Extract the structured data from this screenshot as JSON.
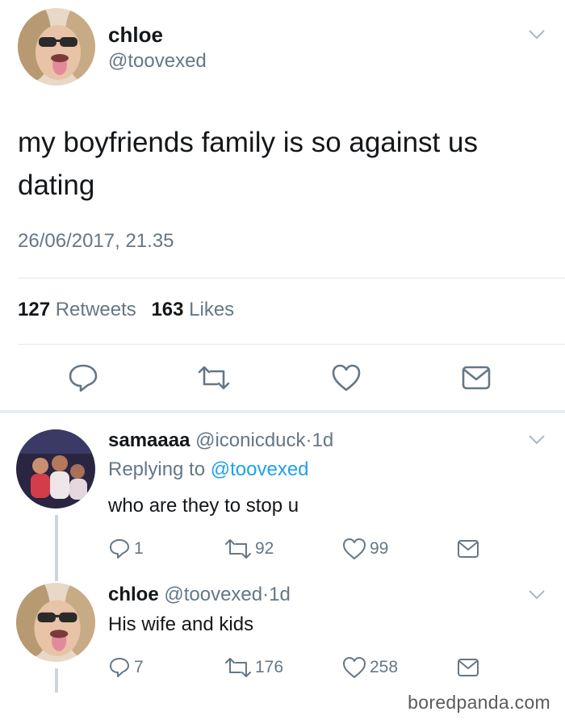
{
  "main_tweet": {
    "name": "chloe",
    "handle": "@toovexed",
    "text": "my boyfriends family is so against us dating",
    "timestamp": "26/06/2017, 21.35",
    "retweets_count": "127",
    "retweets_label": "Retweets",
    "likes_count": "163",
    "likes_label": "Likes",
    "actions": [
      "reply-icon",
      "retweet-icon",
      "like-icon",
      "message-icon"
    ]
  },
  "replies": [
    {
      "name": "samaaaa",
      "handle": "@iconicduck",
      "sep": "·",
      "time": "1d",
      "replying_prefix": "Replying to",
      "replying_to": "@toovexed",
      "text": "who are they to stop u",
      "reply_count": "1",
      "retweet_count": "92",
      "like_count": "99"
    },
    {
      "name": "chloe",
      "handle": "@toovexed",
      "sep": "·",
      "time": "1d",
      "text": "His wife and kids",
      "reply_count": "7",
      "retweet_count": "176",
      "like_count": "258"
    }
  ],
  "watermark": "boredpanda.com",
  "colors": {
    "text": "#14171a",
    "secondary": "#657786",
    "link": "#1da1f2",
    "divider": "#e1e8ed"
  }
}
